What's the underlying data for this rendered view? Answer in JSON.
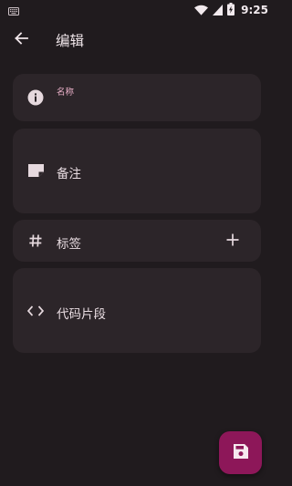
{
  "status_bar": {
    "time": "9:25",
    "icons": [
      "keyboard-icon",
      "wifi-icon",
      "signal-icon",
      "battery-charging-icon"
    ]
  },
  "app_bar": {
    "title": "编辑",
    "back_icon": "arrow-back-icon"
  },
  "form": {
    "name": {
      "caption": "名称",
      "value": "",
      "icon": "info-icon"
    },
    "notes": {
      "label": "备注",
      "icon": "note-icon"
    },
    "tags": {
      "label": "标签",
      "icon": "hash-icon",
      "add_icon": "plus-icon"
    },
    "code": {
      "label": "代码片段",
      "icon": "code-icon"
    }
  },
  "fab": {
    "icon": "save-icon"
  },
  "colors": {
    "background": "#201b1e",
    "card": "#2c2529",
    "accent_text": "#eeb3cb",
    "fab": "#8d1759"
  }
}
